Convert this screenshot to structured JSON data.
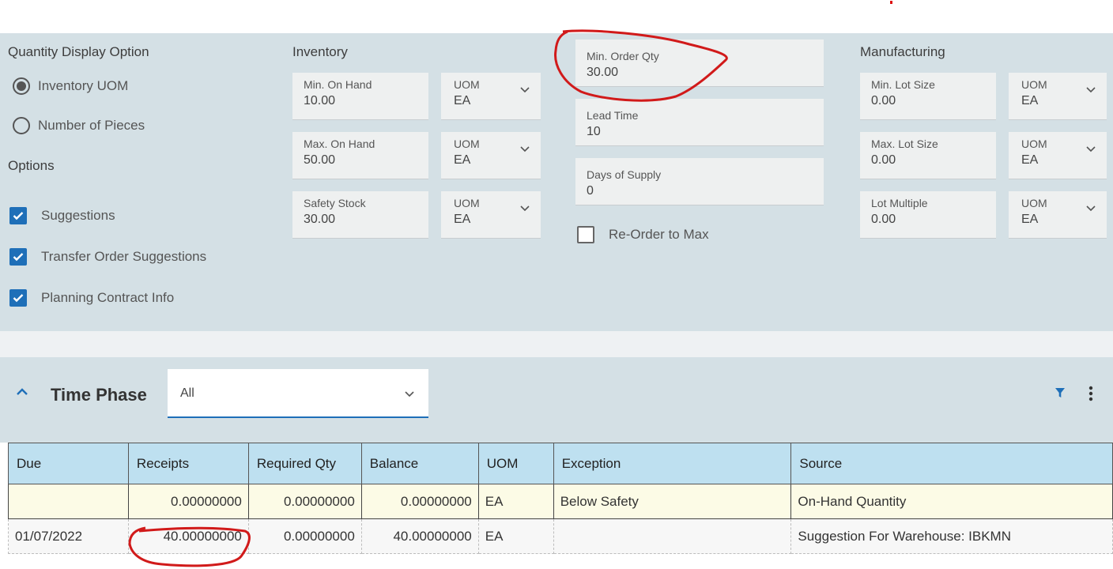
{
  "quantity_display": {
    "title": "Quantity Display Option",
    "options": [
      {
        "label": "Inventory UOM",
        "checked": true
      },
      {
        "label": "Number of Pieces",
        "checked": false
      }
    ]
  },
  "options": {
    "title": "Options",
    "items": [
      {
        "label": "Suggestions",
        "checked": true
      },
      {
        "label": "Transfer Order Suggestions",
        "checked": true
      },
      {
        "label": "Planning Contract Info",
        "checked": true
      }
    ]
  },
  "inventory": {
    "title": "Inventory",
    "fields": [
      {
        "label": "Min. On Hand",
        "value": "10.00",
        "uom_label": "UOM",
        "uom_value": "EA"
      },
      {
        "label": "Max. On Hand",
        "value": "50.00",
        "uom_label": "UOM",
        "uom_value": "EA"
      },
      {
        "label": "Safety Stock",
        "value": "30.00",
        "uom_label": "UOM",
        "uom_value": "EA"
      }
    ]
  },
  "ordering": {
    "fields": [
      {
        "label": "Min. Order Qty",
        "value": "30.00"
      },
      {
        "label": "Lead Time",
        "value": "10"
      },
      {
        "label": "Days of Supply",
        "value": "0"
      }
    ],
    "reorder_label": "Re-Order to Max",
    "reorder_checked": false
  },
  "manufacturing": {
    "title": "Manufacturing",
    "fields": [
      {
        "label": "Min. Lot Size",
        "value": "0.00",
        "uom_label": "UOM",
        "uom_value": "EA"
      },
      {
        "label": "Max. Lot Size",
        "value": "0.00",
        "uom_label": "UOM",
        "uom_value": "EA"
      },
      {
        "label": "Lot Multiple",
        "value": "0.00",
        "uom_label": "UOM",
        "uom_value": "EA"
      }
    ]
  },
  "time_phase": {
    "title": "Time Phase",
    "filter_value": "All",
    "columns": [
      "Due",
      "Receipts",
      "Required Qty",
      "Balance",
      "UOM",
      "Exception",
      "Source"
    ],
    "rows": [
      {
        "due": "",
        "receipts": "0.00000000",
        "required_qty": "0.00000000",
        "balance": "0.00000000",
        "uom": "EA",
        "exception": "Below Safety",
        "source": "On-Hand Quantity"
      },
      {
        "due": "01/07/2022",
        "receipts": "40.00000000",
        "required_qty": "0.00000000",
        "balance": "40.00000000",
        "uom": "EA",
        "exception": "",
        "source": "Suggestion For Warehouse: IBKMN"
      }
    ]
  },
  "colors": {
    "accent": "#1e6fb8",
    "panel": "#d4e0e5",
    "header": "#bee0f0",
    "annotation": "#d11a1a"
  }
}
